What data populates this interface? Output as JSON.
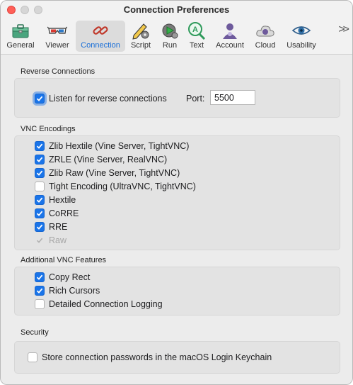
{
  "window": {
    "title": "Connection Preferences"
  },
  "toolbar": {
    "items": [
      {
        "label": "General",
        "icon": "toolbox-icon"
      },
      {
        "label": "Viewer",
        "icon": "3d-glasses-icon"
      },
      {
        "label": "Connection",
        "icon": "chain-link-icon",
        "active": true
      },
      {
        "label": "Script",
        "icon": "pencil-gear-icon"
      },
      {
        "label": "Run",
        "icon": "play-gear-icon"
      },
      {
        "label": "Text",
        "icon": "text-magnifier-icon"
      },
      {
        "label": "Account",
        "icon": "user-gear-icon"
      },
      {
        "label": "Cloud",
        "icon": "cloud-icon"
      },
      {
        "label": "Usability",
        "icon": "eye-icon"
      }
    ],
    "overflow_icon": "chevron-double-right-icon"
  },
  "reverse": {
    "title": "Reverse Connections",
    "listen": {
      "label": "Listen for reverse connections",
      "checked": true
    },
    "port_label": "Port:",
    "port_value": "5500"
  },
  "encodings": {
    "title": "VNC Encodings",
    "items": [
      {
        "label": "Zlib Hextile (Vine Server, TightVNC)",
        "checked": true
      },
      {
        "label": "ZRLE (Vine Server, RealVNC)",
        "checked": true
      },
      {
        "label": "Zlib Raw (Vine Server, TightVNC)",
        "checked": true
      },
      {
        "label": "Tight Encoding (UltraVNC, TightVNC)",
        "checked": false
      },
      {
        "label": "Hextile",
        "checked": true
      },
      {
        "label": "CoRRE",
        "checked": true
      },
      {
        "label": "RRE",
        "checked": true
      },
      {
        "label": "Raw",
        "checked": true,
        "disabled": true
      }
    ]
  },
  "features": {
    "title": "Additional VNC Features",
    "items": [
      {
        "label": "Copy Rect",
        "checked": true
      },
      {
        "label": "Rich Cursors",
        "checked": true
      },
      {
        "label": "Detailed Connection Logging",
        "checked": false
      }
    ]
  },
  "security": {
    "title": "Security",
    "keychain": {
      "label": "Store connection passwords in the macOS Login Keychain",
      "checked": false
    }
  },
  "colors": {
    "accent": "#1a74e8",
    "active_label": "#1a6fd8",
    "close": "#ff5f57"
  }
}
